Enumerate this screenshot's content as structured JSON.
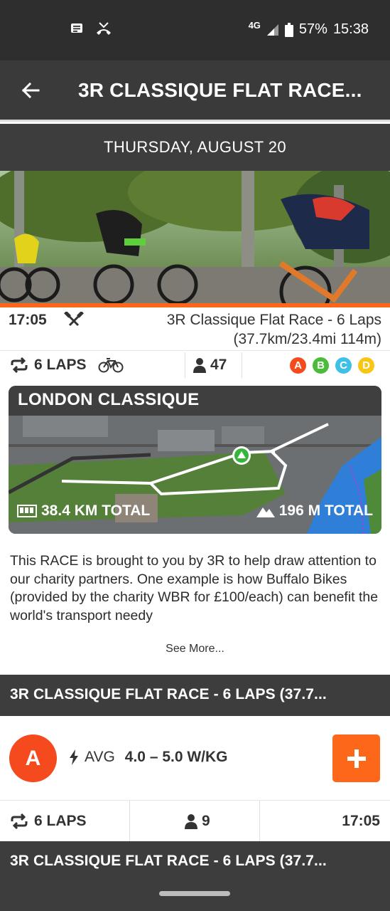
{
  "status": {
    "network": "4G",
    "battery": "57%",
    "time": "15:38"
  },
  "header": {
    "title": "3R CLASSIQUE FLAT RACE..."
  },
  "date": "THURSDAY, AUGUST 20",
  "event": {
    "time": "17:05",
    "name": "3R Classique Flat Race - 6 Laps (37.7km/23.4mi 114m)",
    "laps": "6 LAPS",
    "riders": "47",
    "categories": [
      {
        "label": "A",
        "color": "#f54a1e"
      },
      {
        "label": "B",
        "color": "#4cbb3b"
      },
      {
        "label": "C",
        "color": "#3fc0e8"
      },
      {
        "label": "D",
        "color": "#f8c715"
      }
    ]
  },
  "route": {
    "name": "LONDON CLASSIQUE",
    "distance": "38.4 KM TOTAL",
    "elevation": "196 M TOTAL"
  },
  "description": "This RACE is brought to you by 3R to help draw attention to our charity partners. One example is how Buffalo Bikes (provided by the charity WBR for £100/each) can benefit the world's transport needy",
  "see_more": "See More...",
  "subgroups": [
    {
      "title": "3R CLASSIQUE FLAT RACE - 6 LAPS (37.7...",
      "category": "A",
      "category_color": "#f54a1e",
      "avg_label": "AVG",
      "avg_value": "4.0 – 5.0 W/KG",
      "laps": "6 LAPS",
      "riders": "9",
      "time": "17:05"
    },
    {
      "title": "3R CLASSIQUE FLAT RACE - 6 LAPS (37.7..."
    }
  ],
  "colors": {
    "accent": "#fc6719",
    "dark_bar": "#3d3d3d"
  }
}
